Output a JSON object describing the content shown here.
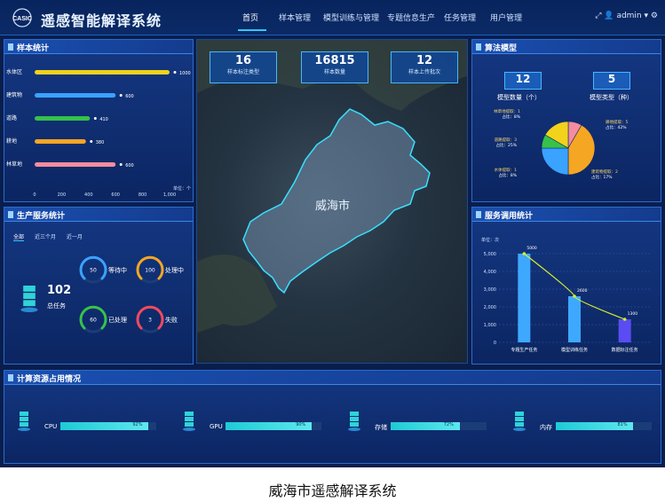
{
  "header": {
    "title": "遥感智能解译系统",
    "logo_text": "CASIC",
    "nav": [
      "首页",
      "样本管理",
      "模型训练与管理",
      "专题信息生产",
      "任务管理",
      "用户管理"
    ],
    "user": "admin"
  },
  "sample_stats": {
    "title": "样本统计",
    "axis_unit": "单位：个",
    "chart_data": {
      "type": "bar",
      "orientation": "horizontal",
      "categories": [
        "水体区",
        "建筑物",
        "道路",
        "耕地",
        "林草地"
      ],
      "values": [
        1000,
        600,
        410,
        380,
        600
      ],
      "value_labels": [
        "1000",
        "600",
        "410",
        "380",
        "600"
      ],
      "x_ticks": [
        "0",
        "200",
        "400",
        "600",
        "800",
        "1,000"
      ],
      "xlim": [
        0,
        1000
      ],
      "colors": [
        "#f2d21b",
        "#3aa2ff",
        "#36c24a",
        "#f5a623",
        "#f48ca0"
      ]
    }
  },
  "production": {
    "title": "生产服务统计",
    "tabs": [
      "全部",
      "近三个月",
      "近一月"
    ],
    "total_value": "102",
    "total_label": "总任务",
    "gauges": [
      {
        "value": "50",
        "label": "等待中",
        "color": "#3aa2ff"
      },
      {
        "value": "100",
        "label": "处理中",
        "color": "#f5a623"
      },
      {
        "value": "60",
        "label": "已处理",
        "color": "#36c24a"
      },
      {
        "value": "3",
        "label": "失败",
        "color": "#f2495c"
      }
    ]
  },
  "map": {
    "stats": [
      {
        "value": "16",
        "label": "样本标注类型"
      },
      {
        "value": "16815",
        "label": "样本数量"
      },
      {
        "value": "12",
        "label": "样本上传批次"
      }
    ],
    "city": "威海市"
  },
  "algorithm": {
    "title": "算法模型",
    "count_value": "12",
    "count_label": "模型数量（个）",
    "type_value": "5",
    "type_label": "模型类型（种）",
    "chart_data": {
      "type": "pie",
      "categories": [
        "林草地提取",
        "耕地提取",
        "道路提取",
        "水体提取",
        "建筑物提取"
      ],
      "values": [
        1,
        5,
        3,
        1,
        2
      ],
      "colors": [
        "#f48ca0",
        "#f5a623",
        "#3aa2ff",
        "#36c24a",
        "#f2d21b"
      ],
      "annotations": [
        {
          "label": "林草地提取：1",
          "pct": "占比：8%"
        },
        {
          "label": "耕地提取：5",
          "pct": "占比：42%"
        },
        {
          "label": "道路提取：3",
          "pct": "占比：25%"
        },
        {
          "label": "水体提取：1",
          "pct": "占比：8%"
        },
        {
          "label": "建筑物提取：2",
          "pct": "占比：17%"
        }
      ]
    }
  },
  "service": {
    "title": "服务调用统计",
    "axis_unit": "单位：次",
    "chart_data": {
      "type": "bar",
      "categories": [
        "专题生产任务",
        "模型训练任务",
        "数据标注任务"
      ],
      "values": [
        5000,
        2600,
        1300
      ],
      "value_labels": [
        "5000",
        "2600",
        "1300"
      ],
      "y_ticks": [
        "0",
        "1,000",
        "2,000",
        "3,000",
        "4,000",
        "5,000"
      ],
      "ylim": [
        0,
        5000
      ],
      "bar_color": "#3ea8ff",
      "line_color": "#d6ef2a"
    }
  },
  "resources": {
    "title": "计算资源占用情况",
    "items": [
      {
        "label": "CPU",
        "value": 0.92,
        "pct": "92%"
      },
      {
        "label": "GPU",
        "value": 0.9,
        "pct": "90%"
      },
      {
        "label": "存储",
        "value": 0.72,
        "pct": "72%"
      },
      {
        "label": "内存",
        "value": 0.81,
        "pct": "81%"
      }
    ]
  },
  "caption": "威海市遥感解译系统"
}
